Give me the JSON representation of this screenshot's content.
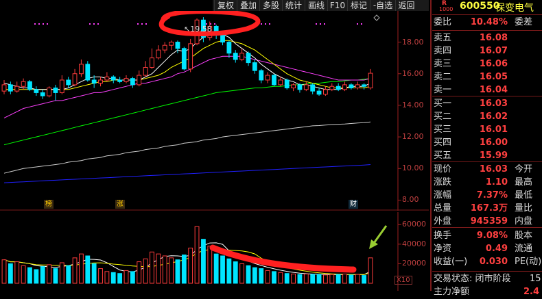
{
  "toolbar": {
    "buttons": [
      "复权",
      "叠加",
      "多股",
      "统计",
      "画线",
      "F10",
      "标记",
      "-自选",
      "返回"
    ]
  },
  "stock": {
    "r_badge": "R",
    "small_code": "1000",
    "code": "600550",
    "name": "保变电气"
  },
  "quote_panel": {
    "wei_bi_label": "委比",
    "wei_bi_value": "10.48%",
    "wei_cha_label": "委差",
    "asks": [
      {
        "label": "卖五",
        "price": "16.08"
      },
      {
        "label": "卖四",
        "price": "16.07"
      },
      {
        "label": "卖三",
        "price": "16.06"
      },
      {
        "label": "卖二",
        "price": "16.05"
      },
      {
        "label": "卖一",
        "price": "16.04"
      }
    ],
    "bids": [
      {
        "label": "买一",
        "price": "16.03"
      },
      {
        "label": "买二",
        "price": "16.02"
      },
      {
        "label": "买三",
        "price": "16.01"
      },
      {
        "label": "买四",
        "price": "16.00"
      },
      {
        "label": "买五",
        "price": "15.99"
      }
    ],
    "stats": [
      {
        "label": "现价",
        "value": "16.03",
        "extra": "今开"
      },
      {
        "label": "涨跌",
        "value": "1.10",
        "extra": "最高"
      },
      {
        "label": "涨幅",
        "value": "7.37%",
        "extra": "最低"
      },
      {
        "label": "总量",
        "value": "167.3万",
        "extra": "量比"
      },
      {
        "label": "外盘",
        "value": "945359",
        "extra": "内盘"
      }
    ],
    "stats2": [
      {
        "label": "换手",
        "value": "9.08%",
        "extra": "股本"
      },
      {
        "label": "净资",
        "value": "0.49",
        "extra": "流通"
      },
      {
        "label": "收益(一)",
        "value": "0.030",
        "extra": "PE(动)"
      }
    ],
    "trade_status": "交易状态: 闭市阶段",
    "trade_status_extra": "15:",
    "bottom_label": "主力净额",
    "bottom_value": "2.4"
  },
  "main_chart": {
    "y_ticks": [
      "18.00",
      "16.00",
      "14.00",
      "12.00",
      "10.00",
      "8.00"
    ],
    "high_label": "19.58",
    "markers": [
      "榜",
      "涨",
      "财"
    ],
    "ylim": [
      7.5,
      19.8
    ]
  },
  "volume_chart": {
    "y_ticks": [
      "60000",
      "40000",
      "20000"
    ],
    "unit_label": "X10",
    "ylim": [
      0,
      70000
    ]
  },
  "colors": {
    "up": "#ff3c3c",
    "down": "#00e5ff",
    "ma5": "#ffffff",
    "ma10": "#ffff00",
    "ma20": "#ff40ff",
    "ma60": "#00ff00",
    "ma120": "#cccccc",
    "ma250": "#2020ff",
    "annotation": "#ff2020"
  },
  "chart_data": {
    "type": "candlestick",
    "candles": [
      {
        "o": 14.9,
        "c": 15.3,
        "h": 15.6,
        "l": 14.7,
        "v": 24000
      },
      {
        "o": 15.3,
        "c": 14.9,
        "h": 15.5,
        "l": 14.7,
        "v": 20000
      },
      {
        "o": 14.9,
        "c": 15.2,
        "h": 15.5,
        "l": 14.8,
        "v": 22000
      },
      {
        "o": 15.2,
        "c": 15.5,
        "h": 15.7,
        "l": 15.0,
        "v": 18000
      },
      {
        "o": 15.5,
        "c": 15.0,
        "h": 15.6,
        "l": 14.9,
        "v": 16000
      },
      {
        "o": 15.0,
        "c": 14.8,
        "h": 15.2,
        "l": 14.6,
        "v": 14000
      },
      {
        "o": 14.8,
        "c": 14.6,
        "h": 15.0,
        "l": 14.4,
        "v": 17000
      },
      {
        "o": 14.6,
        "c": 15.1,
        "h": 15.2,
        "l": 14.5,
        "v": 19000
      },
      {
        "o": 15.1,
        "c": 14.8,
        "h": 15.3,
        "l": 14.3,
        "v": 15000
      },
      {
        "o": 14.8,
        "c": 15.6,
        "h": 15.9,
        "l": 14.7,
        "v": 21000
      },
      {
        "o": 15.6,
        "c": 15.3,
        "h": 15.8,
        "l": 15.1,
        "v": 18000
      },
      {
        "o": 15.3,
        "c": 16.0,
        "h": 16.3,
        "l": 15.2,
        "v": 26000
      },
      {
        "o": 16.0,
        "c": 16.6,
        "h": 16.9,
        "l": 15.8,
        "v": 30000
      },
      {
        "o": 16.6,
        "c": 15.6,
        "h": 16.8,
        "l": 15.5,
        "v": 28000
      },
      {
        "o": 15.6,
        "c": 15.4,
        "h": 15.9,
        "l": 15.1,
        "v": 20000
      },
      {
        "o": 15.4,
        "c": 15.6,
        "h": 15.8,
        "l": 15.2,
        "v": 15000
      },
      {
        "o": 15.6,
        "c": 15.8,
        "h": 16.1,
        "l": 15.5,
        "v": 12000
      },
      {
        "o": 15.8,
        "c": 15.6,
        "h": 15.9,
        "l": 15.4,
        "v": 11000
      },
      {
        "o": 15.6,
        "c": 15.5,
        "h": 15.8,
        "l": 15.4,
        "v": 10000
      },
      {
        "o": 15.5,
        "c": 15.7,
        "h": 15.9,
        "l": 15.4,
        "v": 13000
      },
      {
        "o": 15.7,
        "c": 15.3,
        "h": 15.8,
        "l": 15.1,
        "v": 12000
      },
      {
        "o": 15.3,
        "c": 15.9,
        "h": 16.2,
        "l": 15.2,
        "v": 22000
      },
      {
        "o": 15.9,
        "c": 16.4,
        "h": 16.8,
        "l": 15.8,
        "v": 25000
      },
      {
        "o": 16.4,
        "c": 17.0,
        "h": 17.6,
        "l": 16.3,
        "v": 32000
      },
      {
        "o": 17.0,
        "c": 17.5,
        "h": 17.8,
        "l": 16.9,
        "v": 30000
      },
      {
        "o": 17.5,
        "c": 17.8,
        "h": 18.0,
        "l": 17.3,
        "v": 28000
      },
      {
        "o": 17.8,
        "c": 18.0,
        "h": 18.1,
        "l": 17.5,
        "v": 26000
      },
      {
        "o": 18.0,
        "c": 17.6,
        "h": 18.1,
        "l": 17.3,
        "v": 24000
      },
      {
        "o": 17.6,
        "c": 16.3,
        "h": 17.7,
        "l": 16.2,
        "v": 29000
      },
      {
        "o": 16.3,
        "c": 17.9,
        "h": 18.2,
        "l": 16.1,
        "v": 36000
      },
      {
        "o": 17.9,
        "c": 19.4,
        "h": 19.5,
        "l": 17.8,
        "v": 58000
      },
      {
        "o": 19.4,
        "c": 18.3,
        "h": 19.58,
        "l": 18.0,
        "v": 45000
      },
      {
        "o": 18.3,
        "c": 19.0,
        "h": 19.3,
        "l": 18.1,
        "v": 38000
      },
      {
        "o": 19.0,
        "c": 18.5,
        "h": 19.1,
        "l": 18.2,
        "v": 30000
      },
      {
        "o": 18.5,
        "c": 18.0,
        "h": 18.7,
        "l": 17.8,
        "v": 28000
      },
      {
        "o": 18.0,
        "c": 17.3,
        "h": 18.1,
        "l": 17.0,
        "v": 25000
      },
      {
        "o": 17.3,
        "c": 16.9,
        "h": 17.5,
        "l": 16.7,
        "v": 22000
      },
      {
        "o": 16.9,
        "c": 17.3,
        "h": 17.6,
        "l": 16.8,
        "v": 20000
      },
      {
        "o": 17.3,
        "c": 16.7,
        "h": 17.4,
        "l": 16.5,
        "v": 18000
      },
      {
        "o": 16.7,
        "c": 16.2,
        "h": 16.9,
        "l": 16.0,
        "v": 16000
      },
      {
        "o": 16.2,
        "c": 15.6,
        "h": 16.3,
        "l": 15.4,
        "v": 15000
      },
      {
        "o": 15.6,
        "c": 15.9,
        "h": 16.1,
        "l": 15.4,
        "v": 13000
      },
      {
        "o": 15.9,
        "c": 15.3,
        "h": 16.0,
        "l": 15.2,
        "v": 12000
      },
      {
        "o": 15.3,
        "c": 15.6,
        "h": 15.8,
        "l": 15.2,
        "v": 11000
      },
      {
        "o": 15.6,
        "c": 15.1,
        "h": 15.7,
        "l": 15.0,
        "v": 10000
      },
      {
        "o": 15.1,
        "c": 15.3,
        "h": 15.4,
        "l": 14.9,
        "v": 9500
      },
      {
        "o": 15.3,
        "c": 15.0,
        "h": 15.4,
        "l": 14.8,
        "v": 9000
      },
      {
        "o": 15.0,
        "c": 15.3,
        "h": 15.5,
        "l": 14.9,
        "v": 9500
      },
      {
        "o": 15.3,
        "c": 14.9,
        "h": 15.4,
        "l": 14.7,
        "v": 9000
      },
      {
        "o": 14.9,
        "c": 14.7,
        "h": 15.1,
        "l": 14.6,
        "v": 9000
      },
      {
        "o": 14.7,
        "c": 15.0,
        "h": 15.2,
        "l": 14.6,
        "v": 8500
      },
      {
        "o": 15.0,
        "c": 15.2,
        "h": 15.4,
        "l": 14.9,
        "v": 9000
      },
      {
        "o": 15.2,
        "c": 15.0,
        "h": 15.4,
        "l": 14.9,
        "v": 9000
      },
      {
        "o": 15.0,
        "c": 15.3,
        "h": 15.5,
        "l": 14.9,
        "v": 9500
      },
      {
        "o": 15.3,
        "c": 15.1,
        "h": 15.4,
        "l": 15.0,
        "v": 8500
      },
      {
        "o": 15.1,
        "c": 15.3,
        "h": 15.5,
        "l": 15.0,
        "v": 9000
      },
      {
        "o": 15.3,
        "c": 15.2,
        "h": 15.4,
        "l": 15.0,
        "v": 8000
      },
      {
        "o": 15.1,
        "c": 16.03,
        "h": 16.3,
        "l": 15.0,
        "v": 26000
      }
    ],
    "ma5": [
      15.4,
      15.3,
      15.2,
      15.1,
      15.1,
      15.0,
      15.0,
      15.0,
      15.0,
      15.0,
      15.1,
      15.3,
      15.5,
      15.7,
      15.8,
      15.8,
      15.7,
      15.7,
      15.6,
      15.6,
      15.6,
      15.6,
      15.8,
      16.0,
      16.4,
      16.8,
      17.2,
      17.5,
      17.4,
      17.6,
      18.0,
      18.3,
      18.5,
      18.6,
      18.5,
      18.3,
      17.9,
      17.6,
      17.3,
      17.0,
      16.6,
      16.3,
      16.0,
      15.8,
      15.6,
      15.5,
      15.3,
      15.3,
      15.2,
      15.1,
      15.0,
      15.0,
      15.0,
      15.1,
      15.2,
      15.2,
      15.2,
      15.4
    ],
    "ma10": [
      15.0,
      15.0,
      15.0,
      15.0,
      15.0,
      15.0,
      15.0,
      15.0,
      15.0,
      15.0,
      15.0,
      15.1,
      15.2,
      15.3,
      15.4,
      15.5,
      15.5,
      15.6,
      15.6,
      15.6,
      15.6,
      15.6,
      15.7,
      15.8,
      15.9,
      16.1,
      16.4,
      16.6,
      16.8,
      17.0,
      17.3,
      17.6,
      17.8,
      18.0,
      18.1,
      18.1,
      18.0,
      17.9,
      17.7,
      17.5,
      17.2,
      16.9,
      16.6,
      16.3,
      16.0,
      15.8,
      15.6,
      15.5,
      15.4,
      15.3,
      15.2,
      15.1,
      15.1,
      15.1,
      15.1,
      15.1,
      15.1,
      15.2
    ],
    "ma20": [
      13.2,
      13.4,
      13.6,
      13.8,
      13.9,
      14.0,
      14.1,
      14.2,
      14.3,
      14.3,
      14.4,
      14.5,
      14.6,
      14.7,
      14.8,
      14.8,
      14.9,
      15.0,
      15.1,
      15.2,
      15.3,
      15.4,
      15.4,
      15.5,
      15.6,
      15.7,
      15.8,
      16.0,
      16.1,
      16.3,
      16.5,
      16.7,
      16.9,
      17.0,
      17.1,
      17.1,
      17.1,
      17.1,
      17.0,
      16.9,
      16.8,
      16.7,
      16.6,
      16.5,
      16.4,
      16.3,
      16.2,
      16.1,
      16.0,
      15.9,
      15.8,
      15.7,
      15.6,
      15.6,
      15.6,
      15.6,
      15.6,
      15.7
    ],
    "ma60": [
      11.5,
      11.6,
      11.7,
      11.8,
      11.9,
      12.0,
      12.1,
      12.2,
      12.3,
      12.4,
      12.5,
      12.6,
      12.7,
      12.8,
      12.9,
      13.0,
      13.1,
      13.2,
      13.3,
      13.4,
      13.5,
      13.6,
      13.7,
      13.8,
      13.9,
      14.0,
      14.1,
      14.2,
      14.3,
      14.4,
      14.5,
      14.6,
      14.7,
      14.8,
      14.85,
      14.9,
      14.95,
      15.0,
      15.05,
      15.1,
      15.1,
      15.15,
      15.2,
      15.2,
      15.25,
      15.3,
      15.3,
      15.35,
      15.4,
      15.4,
      15.45,
      15.5,
      15.5,
      15.55,
      15.6,
      15.6,
      15.65,
      15.7
    ],
    "ma120": [
      9.7,
      9.8,
      9.9,
      10.0,
      10.05,
      10.1,
      10.15,
      10.2,
      10.25,
      10.3,
      10.4,
      10.45,
      10.5,
      10.6,
      10.65,
      10.7,
      10.8,
      10.85,
      10.9,
      11.0,
      11.05,
      11.1,
      11.2,
      11.25,
      11.3,
      11.4,
      11.45,
      11.5,
      11.6,
      11.65,
      11.7,
      11.8,
      11.85,
      11.9,
      12.0,
      12.05,
      12.1,
      12.15,
      12.2,
      12.25,
      12.3,
      12.35,
      12.4,
      12.45,
      12.5,
      12.55,
      12.6,
      12.65,
      12.7,
      12.72,
      12.75,
      12.78,
      12.8,
      12.82,
      12.85,
      12.88,
      12.9,
      12.95
    ],
    "ma250": [
      9.1,
      9.12,
      9.14,
      9.16,
      9.18,
      9.2,
      9.22,
      9.24,
      9.26,
      9.28,
      9.3,
      9.32,
      9.34,
      9.36,
      9.38,
      9.4,
      9.42,
      9.44,
      9.46,
      9.48,
      9.5,
      9.52,
      9.54,
      9.56,
      9.58,
      9.6,
      9.62,
      9.64,
      9.66,
      9.68,
      9.7,
      9.72,
      9.74,
      9.76,
      9.78,
      9.8,
      9.82,
      9.84,
      9.86,
      9.88,
      9.9,
      9.92,
      9.94,
      9.96,
      9.98,
      10.0,
      10.02,
      10.04,
      10.06,
      10.08,
      10.1,
      10.12,
      10.14,
      10.16,
      10.18,
      10.2,
      10.22,
      10.25
    ]
  }
}
